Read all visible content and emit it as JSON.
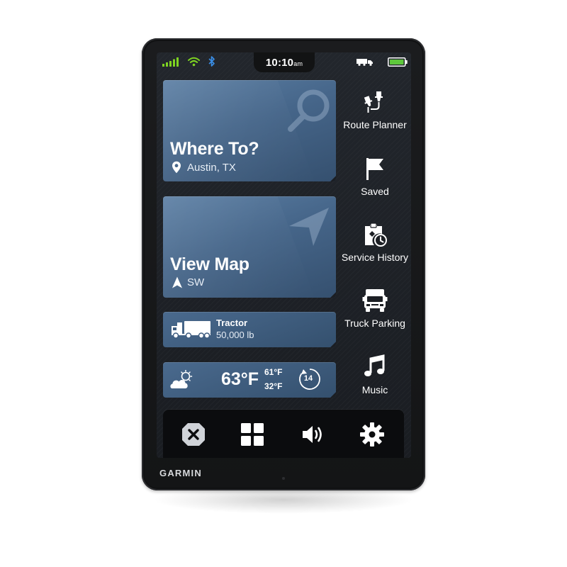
{
  "status_bar": {
    "time": "10:10",
    "ampm": "am"
  },
  "tiles": {
    "where_to": {
      "title": "Where To?",
      "location": "Austin, TX"
    },
    "view_map": {
      "title": "View Map",
      "heading": "SW"
    },
    "vehicle": {
      "name": "Tractor",
      "weight": "50,000 lb"
    },
    "weather": {
      "temperature": "63°F",
      "high": "61°F",
      "low": "32°F",
      "wind_speed": "14"
    }
  },
  "side_menu": [
    {
      "label": "Route Planner",
      "icon": "route-planner-icon"
    },
    {
      "label": "Saved",
      "icon": "flag-icon"
    },
    {
      "label": "Service History",
      "icon": "service-history-icon"
    },
    {
      "label": "Truck Parking",
      "icon": "truck-parking-icon"
    },
    {
      "label": "Music",
      "icon": "music-icon"
    }
  ],
  "dock": [
    {
      "icon": "close-icon"
    },
    {
      "icon": "apps-icon"
    },
    {
      "icon": "volume-icon"
    },
    {
      "icon": "settings-icon"
    }
  ],
  "brand": "GARMIN",
  "colors": {
    "tile_blue": "#46668a",
    "signal_green": "#7ed321",
    "battery_green": "#5ec83c",
    "bluetooth_blue": "#3a8ee6",
    "screen_bg": "#1a1d22",
    "dock_bg": "#0b0c0e"
  }
}
